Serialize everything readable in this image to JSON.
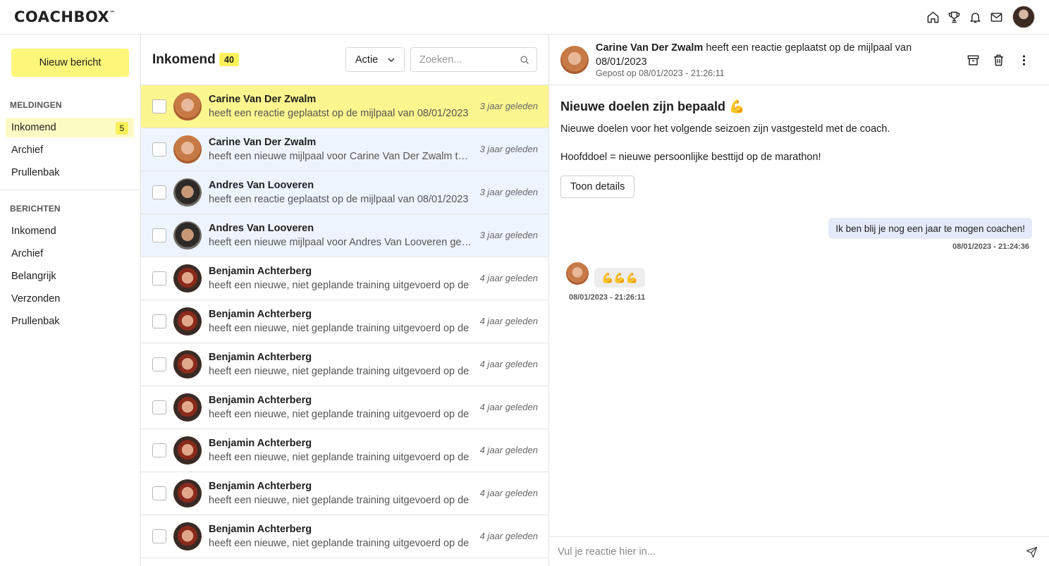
{
  "brand": {
    "logo": "COACHBOX",
    "trademark": "™"
  },
  "topbar": {
    "icons": [
      "home-icon",
      "trophy-icon",
      "bell-icon",
      "mail-icon"
    ],
    "avatar": "user-avatar"
  },
  "sidebar": {
    "new_message_label": "Nieuw bericht",
    "notifications_label": "MELDINGEN",
    "notifications": [
      {
        "label": "Inkomend",
        "badge": "5",
        "active": true
      },
      {
        "label": "Archief"
      },
      {
        "label": "Prullenbak"
      }
    ],
    "messages_label": "BERICHTEN",
    "messages": [
      {
        "label": "Inkomend"
      },
      {
        "label": "Archief"
      },
      {
        "label": "Belangrijk"
      },
      {
        "label": "Verzonden"
      },
      {
        "label": "Prullenbak"
      }
    ]
  },
  "inbox": {
    "title": "Inkomend",
    "count": "40",
    "action_label": "Actie",
    "search_placeholder": "Zoeken...",
    "rows": [
      {
        "name": "Carine Van Der Zwalm",
        "preview": "heeft een reactie geplaatst op de mijlpaal van 08/01/2023",
        "time": "3 jaar geleden",
        "avatar": "carine",
        "state": "selected"
      },
      {
        "name": "Carine Van Der Zwalm",
        "preview": "heeft een nieuwe mijlpaal voor Carine Van Der Zwalm toegevoegd",
        "time": "3 jaar geleden",
        "avatar": "carine",
        "state": "unread"
      },
      {
        "name": "Andres Van Looveren",
        "preview": "heeft een reactie geplaatst op de mijlpaal van 08/01/2023",
        "time": "3 jaar geleden",
        "avatar": "andres",
        "state": "unread"
      },
      {
        "name": "Andres Van Looveren",
        "preview": "heeft een nieuwe mijlpaal voor Andres Van Looveren gemaakt",
        "time": "3 jaar geleden",
        "avatar": "andres",
        "state": "unread"
      },
      {
        "name": "Benjamin Achterberg",
        "preview": "heeft een nieuwe, niet geplande training uitgevoerd op de",
        "time": "4 jaar geleden",
        "avatar": "benjamin",
        "state": "read"
      },
      {
        "name": "Benjamin Achterberg",
        "preview": "heeft een nieuwe, niet geplande training uitgevoerd op de",
        "time": "4 jaar geleden",
        "avatar": "benjamin",
        "state": "read"
      },
      {
        "name": "Benjamin Achterberg",
        "preview": "heeft een nieuwe, niet geplande training uitgevoerd op de",
        "time": "4 jaar geleden",
        "avatar": "benjamin",
        "state": "read"
      },
      {
        "name": "Benjamin Achterberg",
        "preview": "heeft een nieuwe, niet geplande training uitgevoerd op de",
        "time": "4 jaar geleden",
        "avatar": "benjamin",
        "state": "read"
      },
      {
        "name": "Benjamin Achterberg",
        "preview": "heeft een nieuwe, niet geplande training uitgevoerd op de",
        "time": "4 jaar geleden",
        "avatar": "benjamin",
        "state": "read"
      },
      {
        "name": "Benjamin Achterberg",
        "preview": "heeft een nieuwe, niet geplande training uitgevoerd op de",
        "time": "4 jaar geleden",
        "avatar": "benjamin",
        "state": "read"
      },
      {
        "name": "Benjamin Achterberg",
        "preview": "heeft een nieuwe, niet geplande training uitgevoerd op de",
        "time": "4 jaar geleden",
        "avatar": "benjamin",
        "state": "read"
      }
    ]
  },
  "detail": {
    "sender": "Carine Van Der Zwalm",
    "headline": "heeft een reactie geplaatst op de mijlpaal van 08/01/2023",
    "posted": "Gepost op 08/01/2023 - 21:26:11",
    "actions": [
      "archive-icon",
      "trash-icon",
      "more-icon"
    ],
    "title": "Nieuwe doelen zijn bepaald 💪",
    "body_line1": "Nieuwe doelen voor het volgende seizoen zijn vastgesteld met de coach.",
    "body_line2": "Hoofddoel = nieuwe persoonlijke besttijd op de marathon!",
    "details_button": "Toon details",
    "my_message": "Ik ben blij je nog een jaar te mogen coachen!",
    "my_timestamp": "08/01/2023 - 21:24:36",
    "reply_message": "💪💪💪",
    "reply_timestamp": "08/01/2023 - 21:26:11",
    "reply_placeholder": "Vul je reactie hier in..."
  },
  "colors": {
    "accent_yellow": "#fcf67a",
    "unread_blue": "#eef4fd",
    "my_bubble": "#e5eafb"
  }
}
